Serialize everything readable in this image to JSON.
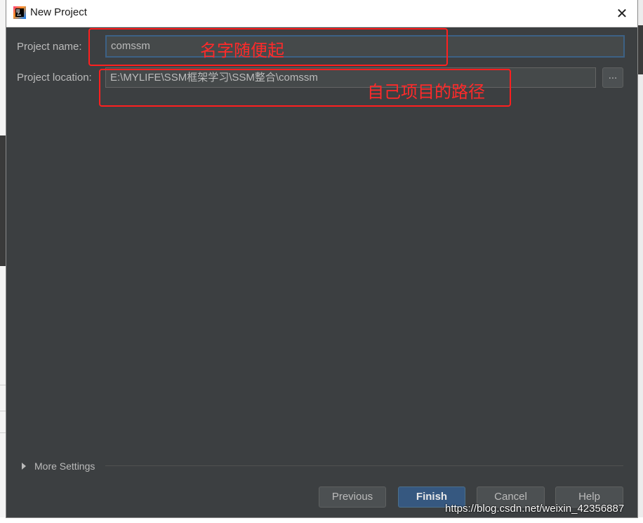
{
  "window": {
    "title": "New Project",
    "close_symbol": "✕",
    "logo_text": "IJ"
  },
  "form": {
    "project_name_label": "Project name:",
    "project_name_value": "comssm",
    "project_location_label": "Project location:",
    "project_location_value": "E:\\MYLIFE\\SSM框架学习\\SSM整合\\comssm",
    "browse_label": "..."
  },
  "annotations": {
    "name_note": "名字随便起",
    "location_note": "自己项目的路径",
    "color": "#ff1f1f"
  },
  "more_settings": {
    "label": "More Settings"
  },
  "buttons": {
    "previous": "Previous",
    "finish": "Finish",
    "cancel": "Cancel",
    "help": "Help"
  },
  "watermark": "https://blog.csdn.net/weixin_42356887",
  "colors": {
    "dialog_background": "#3c3f41",
    "primary_button": "#365880",
    "focus_border": "#3d6185"
  }
}
